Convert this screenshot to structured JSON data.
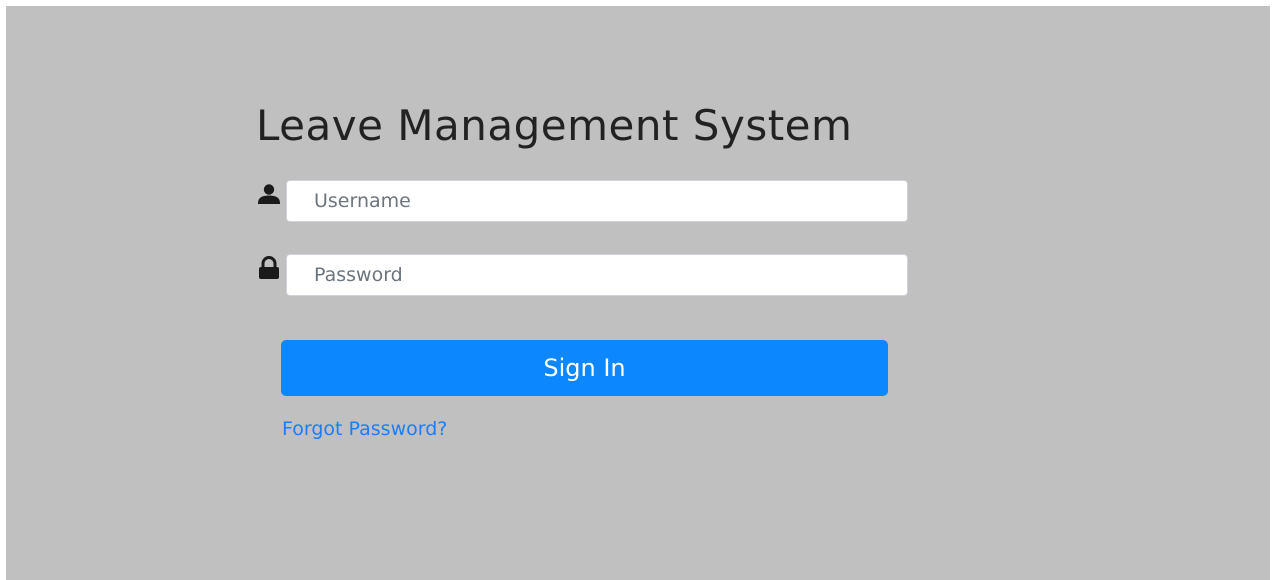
{
  "page": {
    "title": "Leave Management System"
  },
  "login_form": {
    "username": {
      "placeholder": "Username",
      "value": "",
      "icon": "user-icon"
    },
    "password": {
      "placeholder": "Password",
      "value": "",
      "icon": "lock-icon"
    },
    "sign_in_label": "Sign In",
    "forgot_password_label": "Forgot Password?"
  },
  "colors": {
    "background": "#c0c0c0",
    "primary": "#0d87fe",
    "link": "#1a7efb",
    "icon": "#1a1a1a"
  }
}
